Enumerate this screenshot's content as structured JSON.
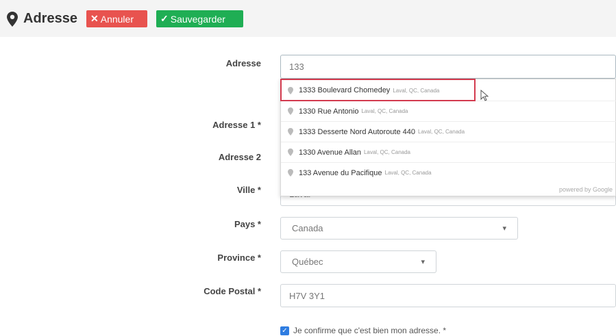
{
  "header": {
    "title": "Adresse",
    "cancel_label": "Annuler",
    "save_label": "Sauvegarder"
  },
  "form": {
    "adresse_label": "Adresse",
    "adresse_value": "133",
    "adresse1_label": "Adresse 1 *",
    "adresse2_label": "Adresse 2",
    "ville_label": "Ville *",
    "ville_value": "Laval",
    "pays_label": "Pays *",
    "pays_value": "Canada",
    "province_label": "Province *",
    "province_value": "Québec",
    "code_postal_label": "Code Postal *",
    "code_postal_value": "H7V 3Y1",
    "confirm_label": "Je confirme que c'est bien mon adresse. *",
    "confirm_checked": true
  },
  "suggestions": [
    {
      "main": "1333 Boulevard Chomedey",
      "secondary": "Laval, QC, Canada"
    },
    {
      "main": "1330 Rue Antonio",
      "secondary": "Laval, QC, Canada"
    },
    {
      "main": "1333 Desserte Nord Autoroute 440",
      "secondary": "Laval, QC, Canada"
    },
    {
      "main": "1330 Avenue Allan",
      "secondary": "Laval, QC, Canada"
    },
    {
      "main": "133 Avenue du Pacifique",
      "secondary": "Laval, QC, Canada"
    }
  ],
  "powered_by": "powered by Google",
  "colors": {
    "cancel": "#e8534f",
    "save": "#1fae54",
    "highlight": "#d33a4e",
    "checkbox": "#2f7de1"
  },
  "icons": {
    "title": "map-marker-icon",
    "cancel": "x-icon",
    "save": "checkmark-icon",
    "suggestion": "map-pin-icon",
    "select": "chevron-down-icon"
  }
}
